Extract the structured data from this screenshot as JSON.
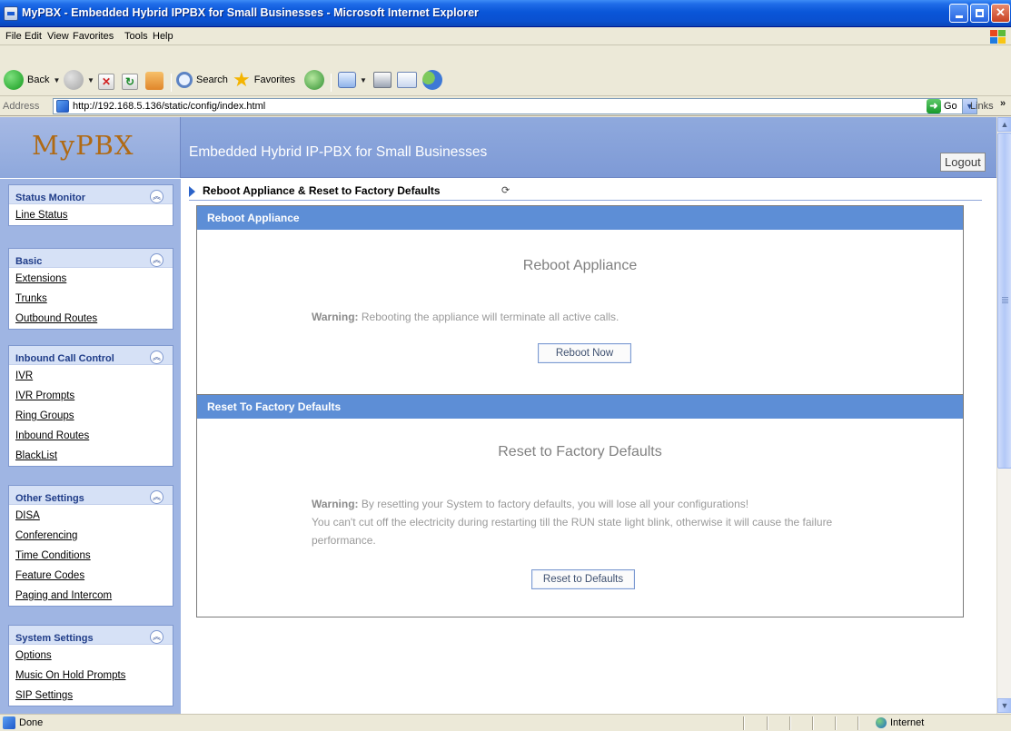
{
  "window": {
    "title": "MyPBX - Embedded Hybrid IPPBX for Small Businesses - Microsoft Internet Explorer"
  },
  "menu": [
    "File",
    "Edit",
    "View",
    "Favorites",
    "Tools",
    "Help"
  ],
  "toolbar": {
    "back_label": "Back",
    "search_label": "Search",
    "favorites_label": "Favorites"
  },
  "address": {
    "label": "Address",
    "url": "http://192.168.5.136/static/config/index.html",
    "go_label": "Go",
    "links_label": "Links"
  },
  "header": {
    "logo": "MyPBX",
    "tagline": "Embedded Hybrid IP-PBX for Small Businesses",
    "logout_label": "Logout"
  },
  "sidebar": {
    "panels": [
      {
        "title": "Status Monitor",
        "items": [
          "Line Status"
        ]
      },
      {
        "title": "Basic",
        "items": [
          "Extensions",
          "Trunks",
          "Outbound Routes"
        ]
      },
      {
        "title": "Inbound Call Control",
        "items": [
          "IVR",
          "IVR Prompts",
          "Ring Groups",
          "Inbound Routes",
          "BlackList"
        ]
      },
      {
        "title": "Other Settings",
        "items": [
          "DISA",
          "Conferencing",
          "Time Conditions",
          "Feature Codes",
          "Paging and Intercom"
        ]
      },
      {
        "title": "System Settings",
        "items": [
          "Options",
          "Music On Hold Prompts",
          "SIP Settings"
        ]
      }
    ]
  },
  "main": {
    "breadcrumb": "Reboot Appliance & Reset to Factory Defaults",
    "reboot": {
      "header": "Reboot Appliance",
      "title": "Reboot Appliance",
      "warning_label": "Warning:",
      "warning_text": " Rebooting the appliance will terminate all active calls.",
      "button": "Reboot Now"
    },
    "reset": {
      "header": "Reset To Factory Defaults",
      "title": "Reset to Factory Defaults",
      "warning_label": "Warning:",
      "warning_text": " By resetting your System to factory defaults, you will lose all your configurations!",
      "warning_line2": "You can't cut off the electricity during restarting till the RUN state light blink, otherwise it will cause the failure",
      "warning_line3": "performance.",
      "button": "Reset to Defaults"
    }
  },
  "status": {
    "text": "Done",
    "zone": "Internet"
  },
  "colors": {
    "titlebar": "#0a56d8",
    "section_header": "#5d8ed6",
    "sidebar_title": "#1f3c88",
    "logo": "#b06a14"
  }
}
